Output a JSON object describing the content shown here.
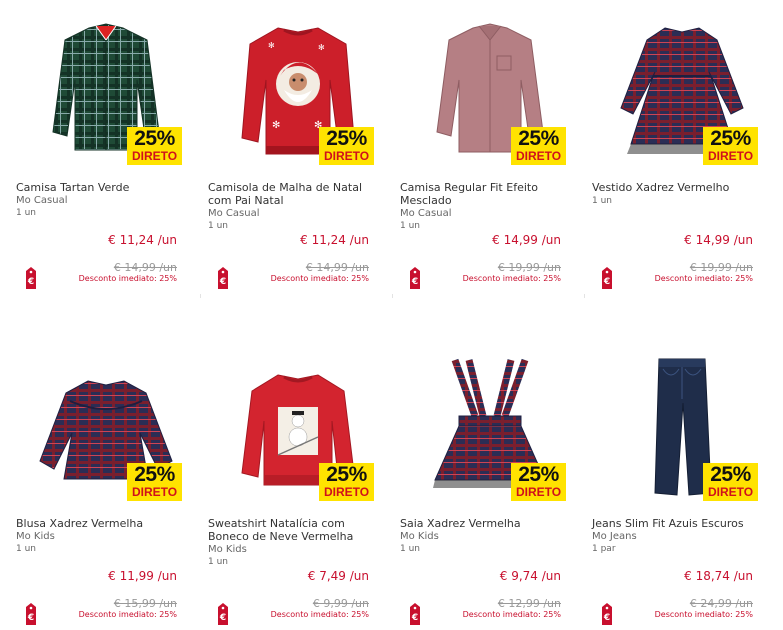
{
  "products": [
    {
      "name": "Camisa Tartan Verde",
      "brand": "Mo Casual",
      "unit": "1 un",
      "price": "€ 11,24 /un",
      "old_price": "€ 14,99 /un",
      "discount": "Desconto imediato: 25%",
      "promo_pct": "25%",
      "promo_label": "DIRETO",
      "icon": "plaid-shirt-image"
    },
    {
      "name": "Camisola de Malha de Natal com Pai Natal",
      "brand": "Mo Casual",
      "unit": "1 un",
      "price": "€ 11,24 /un",
      "old_price": "€ 14,99 /un",
      "discount": "Desconto imediato: 25%",
      "promo_pct": "25%",
      "promo_label": "DIRETO",
      "icon": "santa-sweater-image"
    },
    {
      "name": "Camisa Regular Fit Efeito Mesclado",
      "brand": "Mo Casual",
      "unit": "1 un",
      "price": "€ 14,99 /un",
      "old_price": "€ 19,99 /un",
      "discount": "Desconto imediato: 25%",
      "promo_pct": "25%",
      "promo_label": "DIRETO",
      "icon": "shirt-image"
    },
    {
      "name": "Vestido Xadrez Vermelho",
      "brand": "",
      "unit": "1 un",
      "price": "€ 14,99 /un",
      "old_price": "€ 19,99 /un",
      "discount": "Desconto imediato: 25%",
      "promo_pct": "25%",
      "promo_label": "DIRETO",
      "icon": "plaid-dress-image"
    },
    {
      "name": "Blusa Xadrez Vermelha",
      "brand": "Mo Kids",
      "unit": "1 un",
      "price": "€ 11,99 /un",
      "old_price": "€ 15,99 /un",
      "discount": "Desconto imediato: 25%",
      "promo_pct": "25%",
      "promo_label": "DIRETO",
      "icon": "plaid-blouse-image"
    },
    {
      "name": "Sweatshirt Natalícia com Boneco de Neve Vermelha",
      "brand": "Mo Kids",
      "unit": "1 un",
      "price": "€ 7,49 /un",
      "old_price": "€ 9,99 /un",
      "discount": "Desconto imediato: 25%",
      "promo_pct": "25%",
      "promo_label": "DIRETO",
      "icon": "snowman-sweatshirt-image"
    },
    {
      "name": "Saia Xadrez Vermelha",
      "brand": "Mo Kids",
      "unit": "1 un",
      "price": "€ 9,74 /un",
      "old_price": "€ 12,99 /un",
      "discount": "Desconto imediato: 25%",
      "promo_pct": "25%",
      "promo_label": "DIRETO",
      "icon": "plaid-skirt-image"
    },
    {
      "name": "Jeans Slim Fit Azuis Escuros",
      "brand": "Mo Jeans",
      "unit": "1 par",
      "price": "€ 18,74 /un",
      "old_price": "€ 24,99 /un",
      "discount": "Desconto imediato: 25%",
      "promo_pct": "25%",
      "promo_label": "DIRETO",
      "icon": "jeans-image"
    }
  ],
  "colors": {
    "accent": "#c8102e",
    "promo_bg": "#ffe300",
    "tag": "#c8102e"
  }
}
